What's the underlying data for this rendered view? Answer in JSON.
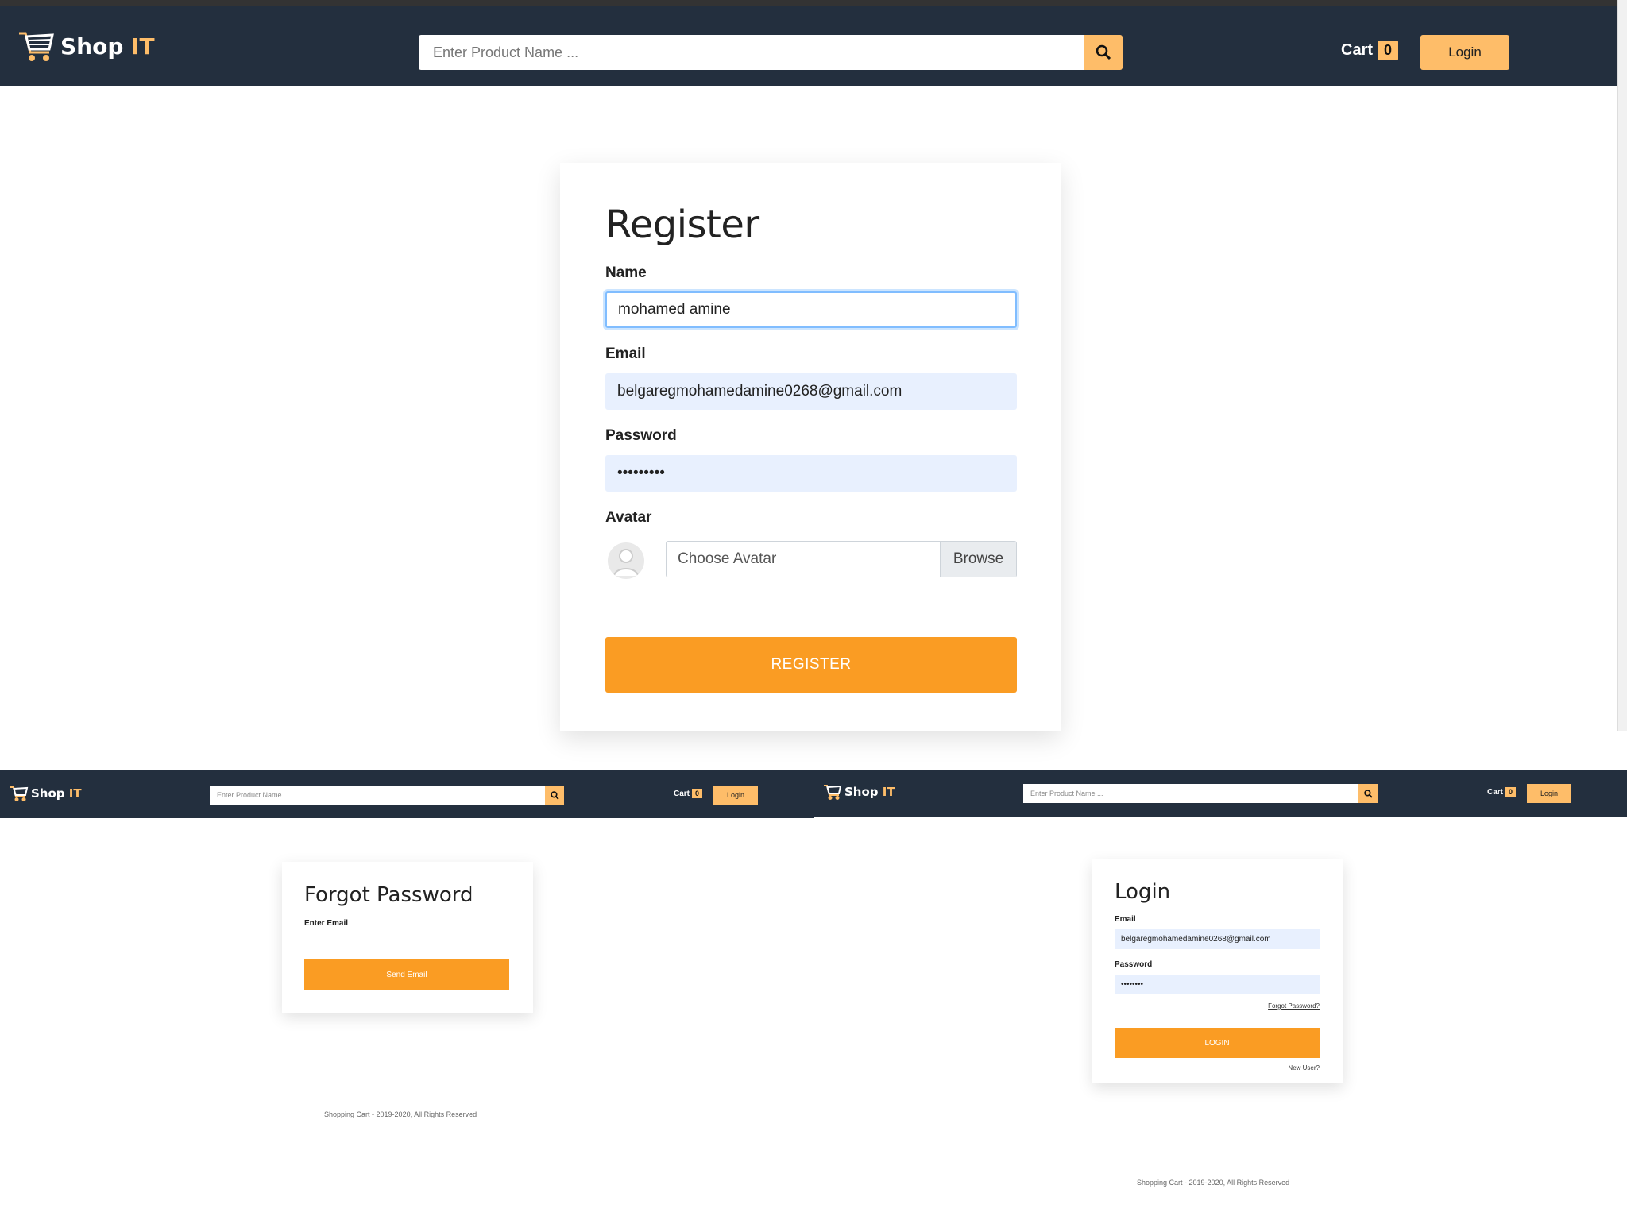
{
  "main": {
    "brand": {
      "name_main": "Shop ",
      "name_accent": "IT"
    },
    "search": {
      "placeholder": "Enter Product Name ..."
    },
    "cart": {
      "label": "Cart",
      "count": "0"
    },
    "login_label": "Login",
    "register": {
      "title": "Register",
      "name_label": "Name",
      "name_value": "mohamed amine",
      "email_label": "Email",
      "email_value": "belgaregmohamedamine0268@gmail.com",
      "password_label": "Password",
      "password_value": "•••••••••",
      "avatar_label": "Avatar",
      "avatar_file_text": "Choose Avatar",
      "browse_label": "Browse",
      "submit_label": "REGISTER"
    }
  },
  "forgot_window": {
    "brand": {
      "name_main": "Shop ",
      "name_accent": "IT"
    },
    "search": {
      "placeholder": "Enter Product Name ..."
    },
    "cart": {
      "label": "Cart",
      "count": "0"
    },
    "login_label": "Login",
    "title": "Forgot Password",
    "email_label": "Enter Email",
    "submit_label": "Send Email",
    "footer": "Shopping Cart - 2019-2020, All Rights Reserved"
  },
  "login_window": {
    "brand": {
      "name_main": "Shop ",
      "name_accent": "IT"
    },
    "search": {
      "placeholder": "Enter Product Name ..."
    },
    "cart": {
      "label": "Cart",
      "count": "0"
    },
    "login_label": "Login",
    "title": "Login",
    "email_label": "Email",
    "email_value": "belgaregmohamedamine0268@gmail.com",
    "password_label": "Password",
    "password_value": "••••••••",
    "forgot_link": "Forgot Password?",
    "submit_label": "LOGIN",
    "new_user_link": "New User?",
    "footer": "Shopping Cart - 2019-2020, All Rights Reserved"
  },
  "colors": {
    "nav": "#232f3e",
    "accent": "#febd69",
    "button": "#fa9c23",
    "autofill": "#e8f0fe"
  }
}
